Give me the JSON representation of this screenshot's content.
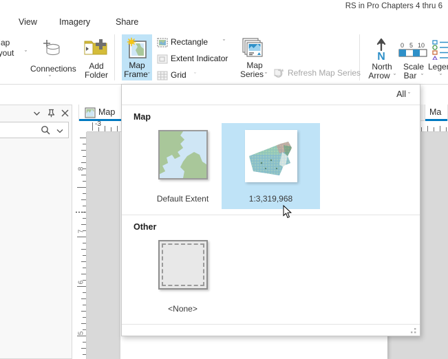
{
  "window": {
    "doc_title": "RS in Pro Chapters 4 thru 6"
  },
  "ribbon": {
    "tabs": [
      {
        "label": "View"
      },
      {
        "label": "Imagery"
      },
      {
        "label": "Share"
      }
    ],
    "groups": {
      "map_layout": {
        "line1": "Map",
        "line2": "ayout",
        "chevron": "ˇ"
      },
      "connections": {
        "label": "Connections",
        "chevron": "ˇ",
        "icon": "database-connections-icon"
      },
      "add_folder": {
        "line1": "Add",
        "line2": "Folder",
        "icon": "add-folder-icon"
      },
      "map_frame": {
        "line1": "Map",
        "line2": "Frame",
        "chevron": "ˇ",
        "icon": "map-frame-icon",
        "active": true
      },
      "rectangle": {
        "label": "Rectangle",
        "chevron": "ˇ",
        "icon": "rectangle-icon",
        "disabled": false
      },
      "extent_indicator": {
        "label": "Extent Indicator",
        "chevron": "ˇ",
        "icon": "extent-indicator-icon",
        "disabled": true
      },
      "grid": {
        "label": "Grid",
        "chevron": "ˇ",
        "icon": "grid-icon",
        "disabled": true
      },
      "map_series": {
        "line1": "Map",
        "line2": "Series",
        "chevron": "ˇ",
        "icon": "map-series-icon"
      },
      "refresh_map_series": {
        "label": "Refresh Map Series",
        "icon": "refresh-icon",
        "disabled": true
      },
      "north_arrow": {
        "line1": "North",
        "line2": "Arrow",
        "chevron": "ˇ",
        "icon": "north-arrow-icon"
      },
      "scale_bar": {
        "line1": "Scale",
        "line2": "Bar",
        "chevron": "ˇ",
        "icon": "scale-bar-icon",
        "tick_labels": [
          "0",
          "5",
          "10"
        ]
      },
      "legend": {
        "label": "Legen",
        "chevron": "ˇ",
        "icon": "legend-icon"
      }
    }
  },
  "left_pane": {
    "collapse_icon": "chevron-down-icon",
    "pin_icon": "pin-icon",
    "close_icon": "close-icon",
    "search": {
      "value": "",
      "placeholder": "",
      "search_icon": "search-icon",
      "dropdown_icon": "chevron-down-icon"
    }
  },
  "document_tabs": [
    {
      "label": "Map",
      "icon": "map-icon",
      "active": true
    },
    {
      "label": "Ma",
      "icon": "",
      "active": true
    }
  ],
  "rulers": {
    "horizontal_labels": [
      "-3"
    ],
    "vertical_labels": [
      "8",
      "7",
      "6",
      "5"
    ],
    "units_note": ""
  },
  "gallery": {
    "filter": {
      "label": "All",
      "chevron": "ˇ"
    },
    "sections": [
      {
        "title": "Map",
        "items": [
          {
            "caption": "Default Extent",
            "thumb": "default-extent-thumbnail",
            "selected": false
          },
          {
            "caption": "1:3,319,968",
            "thumb": "raster-map-thumbnail",
            "selected": true
          }
        ]
      },
      {
        "title": "Other",
        "items": [
          {
            "caption": "<None>",
            "thumb": "none-thumbnail",
            "selected": false
          }
        ]
      }
    ],
    "resize_grip": "resize-grip-icon"
  },
  "colors": {
    "accent_blue": "#0079c1",
    "highlight_blue": "#bfe3f7",
    "folder_yellow": "#d4bc39",
    "land_green": "#a9c79a",
    "water_blue": "#cfe6f5",
    "canvas_gray": "#d9d9d9"
  }
}
